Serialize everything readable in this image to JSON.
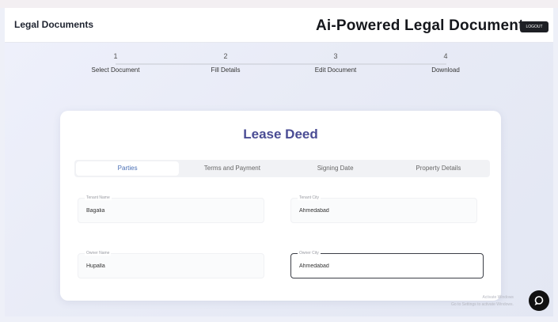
{
  "header": {
    "brand": "Legal Documents",
    "title": "Ai-Powered Legal Documents",
    "login_label": "LOGOUT"
  },
  "stepper": {
    "steps": [
      {
        "number": "1",
        "label": "Select Document"
      },
      {
        "number": "2",
        "label": "Fill Details"
      },
      {
        "number": "3",
        "label": "Edit Document"
      },
      {
        "number": "4",
        "label": "Download"
      }
    ]
  },
  "form": {
    "title": "Lease Deed",
    "tabs": [
      {
        "label": "Parties",
        "active": true
      },
      {
        "label": "Terms and Payment",
        "active": false
      },
      {
        "label": "Signing Date",
        "active": false
      },
      {
        "label": "Property Details",
        "active": false
      }
    ],
    "fields": [
      {
        "label": "Tenant Name",
        "value": "Bagalia"
      },
      {
        "label": "Tenant City",
        "value": "Ahmedabad"
      },
      {
        "label": "Owner Name",
        "value": "Hupalla"
      },
      {
        "label": "Owner City",
        "value": "Ahmedabad"
      }
    ]
  },
  "footer": {
    "watermark_line1": "Activate Windows",
    "watermark_line2": "Go to Settings to activate Windows."
  },
  "icons": {
    "chat": "chat-bubble-icon"
  }
}
